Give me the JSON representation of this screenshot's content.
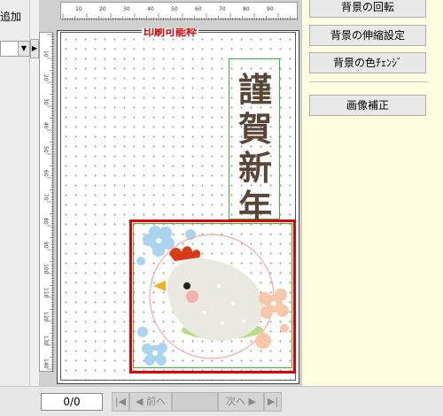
{
  "left": {
    "add_label": "追加"
  },
  "ruler": {
    "top_ticks": [
      "10",
      "20",
      "30",
      "40",
      "50",
      "60",
      "70",
      "80",
      "90"
    ],
    "left_ticks": [
      "10",
      "20",
      "30",
      "40",
      "50",
      "60",
      "70",
      "80",
      "90",
      "100",
      "110",
      "120",
      "130",
      "140"
    ]
  },
  "canvas": {
    "print_label": "印刷可能枠",
    "greeting": [
      "謹",
      "賀",
      "新",
      "年"
    ]
  },
  "right_panel": {
    "rotate_bg": "背景の回転",
    "stretch_bg": "背景の伸縮設定",
    "change_color": "背景の色ﾁｪﾝｼﾞ",
    "image_correct": "画像補正"
  },
  "status": {
    "page_counter": "0/0",
    "prev": "前へ",
    "next": "次へ"
  },
  "colors": {
    "selection": "#e00000",
    "guide": "#35b835",
    "panel": "#fffde0"
  }
}
